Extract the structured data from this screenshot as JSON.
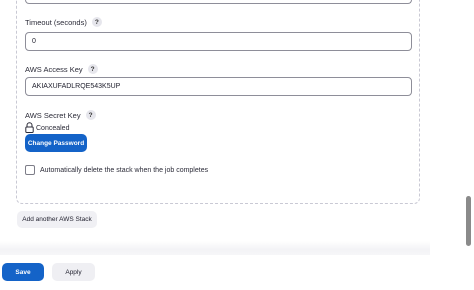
{
  "timeout": {
    "label": "Timeout (seconds)",
    "help": "?",
    "value": "0"
  },
  "access_key": {
    "label": "AWS Access Key",
    "help": "?",
    "value": "AKIAXUFADLRQE543K5UP"
  },
  "secret_key": {
    "label": "AWS Secret Key",
    "help": "?",
    "status": "Concealed",
    "icon": "lock-icon",
    "change_label": "Change Password"
  },
  "auto_delete": {
    "label": "Automatically delete the stack when the job completes",
    "checked": false
  },
  "add_stack_label": "Add another AWS Stack",
  "footer": {
    "save_label": "Save",
    "apply_label": "Apply"
  },
  "colors": {
    "primary": "#1463c8",
    "secondary_button": "#efeff3",
    "border": "#8e8e99"
  }
}
